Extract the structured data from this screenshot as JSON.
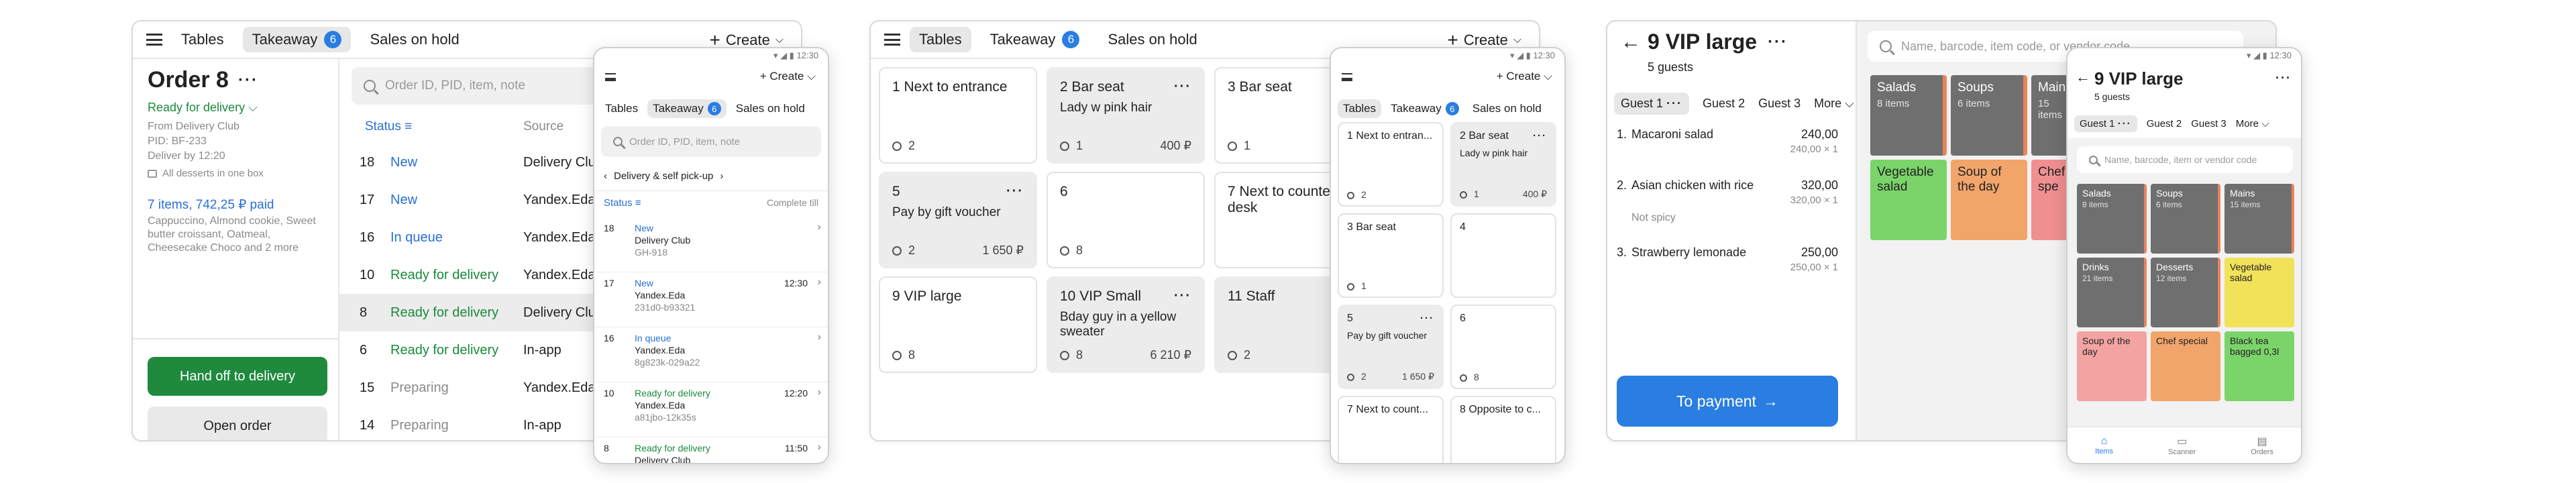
{
  "panel1": {
    "tabs": [
      "Tables",
      "Takeaway",
      "Sales on hold"
    ],
    "takeaway_count": "6",
    "create_label": "Create",
    "order": {
      "title": "Order 8",
      "status": "Ready for delivery",
      "from": "From Delivery Club",
      "pid": "PID: BF-233",
      "deliver": "Deliver by 12:20",
      "note": "All desserts in one box",
      "summary": "7 items, 742,25 ₽ paid",
      "items": "Cappuccino, Almond cookie, Sweet butter croissant, Oatmeal, Cheesecake Choco and 2 more",
      "primary_button": "Hand off to delivery",
      "secondary_button": "Open order"
    },
    "search_placeholder": "Order ID, PID, item, note",
    "columns": [
      "Status",
      "Source"
    ],
    "rows": [
      {
        "id": "18",
        "status": "New",
        "source": "Delivery Club",
        "color": "#2a6fd6"
      },
      {
        "id": "17",
        "status": "New",
        "source": "Yandex.Eda",
        "color": "#2a6fd6"
      },
      {
        "id": "16",
        "status": "In queue",
        "source": "Yandex.Eda",
        "color": "#2a6fd6"
      },
      {
        "id": "10",
        "status": "Ready for delivery",
        "source": "Yandex.Eda",
        "color": "#1a8a3c"
      },
      {
        "id": "8",
        "status": "Ready for delivery",
        "source": "Delivery Club",
        "color": "#1a8a3c"
      },
      {
        "id": "6",
        "status": "Ready for delivery",
        "source": "In-app",
        "color": "#1a8a3c"
      },
      {
        "id": "15",
        "status": "Preparing",
        "source": "Yandex.Eda",
        "color": "#8a8a8a"
      },
      {
        "id": "14",
        "status": "Preparing",
        "source": "In-app",
        "color": "#8a8a8a"
      }
    ]
  },
  "phone1": {
    "time": "12:30",
    "create_label": "Create",
    "tabs": [
      "Tables",
      "Takeaway",
      "Sales on hold"
    ],
    "takeaway_count": "6",
    "search_placeholder": "Order ID, PID, item, note",
    "filter": "Delivery & self pick-up",
    "col_status": "Status",
    "col_right": "Complete till",
    "rows": [
      {
        "id": "18",
        "status": "New",
        "l1": "Delivery Club",
        "l2": "GH-918",
        "time": "",
        "color": "#2a6fd6"
      },
      {
        "id": "17",
        "status": "New",
        "l1": "Yandex.Eda",
        "l2": "231d0-b93321",
        "time": "12:30",
        "color": "#2a6fd6"
      },
      {
        "id": "16",
        "status": "In queue",
        "l1": "Yandex.Eda",
        "l2": "8g823k-029a22",
        "time": "",
        "color": "#2a6fd6"
      },
      {
        "id": "10",
        "status": "Ready for delivery",
        "l1": "Yandex.Eda",
        "l2": "a81jbo-12k35s",
        "time": "12:20",
        "color": "#1a8a3c"
      },
      {
        "id": "8",
        "status": "Ready for delivery",
        "l1": "Delivery Club",
        "l2": "",
        "time": "11:50",
        "color": "#1a8a3c"
      }
    ]
  },
  "panel2": {
    "tabs": [
      "Tables",
      "Takeaway",
      "Sales on hold"
    ],
    "takeaway_count": "6",
    "create_label": "Create",
    "tables": [
      {
        "name": "1 Next to entrance",
        "desc": "",
        "guests": "2",
        "amount": ""
      },
      {
        "name": "2 Bar seat",
        "desc": "Lady w pink hair",
        "guests": "1",
        "amount": "400 ₽"
      },
      {
        "name": "3 Bar seat",
        "desc": "",
        "guests": "1",
        "amount": ""
      },
      {
        "name": "5",
        "desc": "Pay by gift voucher",
        "guests": "2",
        "amount": "1 650 ₽"
      },
      {
        "name": "6",
        "desc": "",
        "guests": "8",
        "amount": ""
      },
      {
        "name": "7 Next to counter desk",
        "desc": "",
        "guests": "",
        "amount": ""
      },
      {
        "name": "9 VIP large",
        "desc": "",
        "guests": "8",
        "amount": ""
      },
      {
        "name": "10 VIP Small",
        "desc": "Bday guy in a yellow sweater",
        "guests": "8",
        "amount": "6 210 ₽"
      },
      {
        "name": "11 Staff",
        "desc": "",
        "guests": "2",
        "amount": ""
      }
    ]
  },
  "phone2": {
    "time": "12:30",
    "create_label": "Create",
    "tabs": [
      "Tables",
      "Takeaway",
      "Sales on hold"
    ],
    "takeaway_count": "6",
    "tables": [
      {
        "name": "1 Next to entran...",
        "desc": "",
        "guests": "2",
        "amount": ""
      },
      {
        "name": "2 Bar seat",
        "desc": "Lady w pink hair",
        "guests": "1",
        "amount": "400 ₽"
      },
      {
        "name": "3 Bar seat",
        "desc": "",
        "guests": "1",
        "amount": ""
      },
      {
        "name": "4",
        "desc": "",
        "guests": "",
        "amount": ""
      },
      {
        "name": "5",
        "desc": "Pay by gift voucher",
        "guests": "2",
        "amount": "1 650 ₽"
      },
      {
        "name": "6",
        "desc": "",
        "guests": "8",
        "amount": ""
      },
      {
        "name": "7 Next to count...",
        "desc": "",
        "guests": "",
        "amount": ""
      },
      {
        "name": "8 Opposite to c...",
        "desc": "",
        "guests": "",
        "amount": ""
      }
    ]
  },
  "panel3": {
    "title": "9 VIP large",
    "guests": "5 guests",
    "guest_tabs": [
      "Guest 1",
      "Guest 2",
      "Guest 3",
      "More"
    ],
    "items": [
      {
        "n": "1.",
        "name": "Macaroni salad",
        "price": "240,00",
        "sub": "240,00 × 1",
        "note": ""
      },
      {
        "n": "2.",
        "name": "Asian chicken with rice",
        "price": "320,00",
        "sub": "320,00 × 1",
        "note": "Not spicy"
      },
      {
        "n": "3.",
        "name": "Strawberry lemonade",
        "price": "250,00",
        "sub": "250,00 × 1",
        "note": ""
      }
    ],
    "pay_button": "To payment",
    "search_placeholder": "Name, barcode, item code, or vendor code",
    "tiles": [
      {
        "name": "Salads",
        "sub": "8 items",
        "color": "#6f6f6f"
      },
      {
        "name": "Soups",
        "sub": "6 items",
        "color": "#6f6f6f"
      },
      {
        "name": "Mains",
        "sub": "15 items",
        "color": "#6f6f6f"
      },
      {
        "name": "Vegetable salad",
        "sub": "",
        "color": "#7bd46a"
      },
      {
        "name": "Soup of the day",
        "sub": "",
        "color": "#f2a56b"
      },
      {
        "name": "Chef spe",
        "sub": "",
        "color": "#f08f8f"
      }
    ]
  },
  "phone3": {
    "time": "12:30",
    "title": "9 VIP large",
    "guests": "5 guests",
    "guest_tabs": [
      "Guest 1",
      "Guest 2",
      "Guest 3",
      "More"
    ],
    "search_placeholder": "Name, barcode, item or vendor code",
    "tiles": [
      {
        "name": "Salads",
        "sub": "8 items",
        "color": "#6f6f6f",
        "dark": true
      },
      {
        "name": "Soups",
        "sub": "6 items",
        "color": "#6f6f6f",
        "dark": true
      },
      {
        "name": "Mains",
        "sub": "15 items",
        "color": "#6f6f6f",
        "dark": true
      },
      {
        "name": "Drinks",
        "sub": "21 items",
        "color": "#6f6f6f",
        "dark": true
      },
      {
        "name": "Desserts",
        "sub": "12 items",
        "color": "#6f6f6f",
        "dark": true
      },
      {
        "name": "Vegetable salad",
        "sub": "",
        "color": "#f1e25a",
        "dark": false
      },
      {
        "name": "Soup of the day",
        "sub": "",
        "color": "#f4a3a3",
        "dark": false
      },
      {
        "name": "Chef special",
        "sub": "",
        "color": "#f2a56b",
        "dark": false
      },
      {
        "name": "Black tea bagged 0,3l",
        "sub": "",
        "color": "#7bd46a",
        "dark": false
      }
    ],
    "nav": [
      "Items",
      "Scanner",
      "Orders"
    ]
  }
}
